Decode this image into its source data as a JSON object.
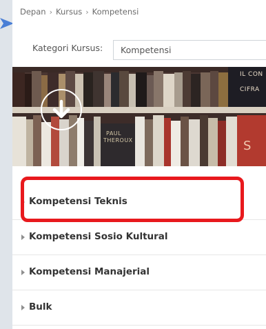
{
  "breadcrumb": {
    "items": [
      "Depan",
      "Kursus",
      "Kompetensi"
    ],
    "separator": "›"
  },
  "category_filter": {
    "label": "Kategori Kursus:",
    "selected_value": "Kompetensi"
  },
  "banner": {
    "visible_text": [
      "PAUL",
      "THEROUX",
      "IL CON",
      "CIFRA",
      "S"
    ],
    "download_icon": "arrow-down-circle-icon"
  },
  "courses": {
    "items": [
      {
        "label": "Kompetensi Teknis",
        "highlighted": true
      },
      {
        "label": "Kompetensi Sosio Kultural",
        "highlighted": false
      },
      {
        "label": "Kompetensi Manajerial",
        "highlighted": false
      },
      {
        "label": "Bulk",
        "highlighted": false
      }
    ]
  },
  "colors": {
    "highlight_border": "#e8191d",
    "pointer_arrow": "#4a7fd6",
    "background": "#dfe4ea"
  }
}
